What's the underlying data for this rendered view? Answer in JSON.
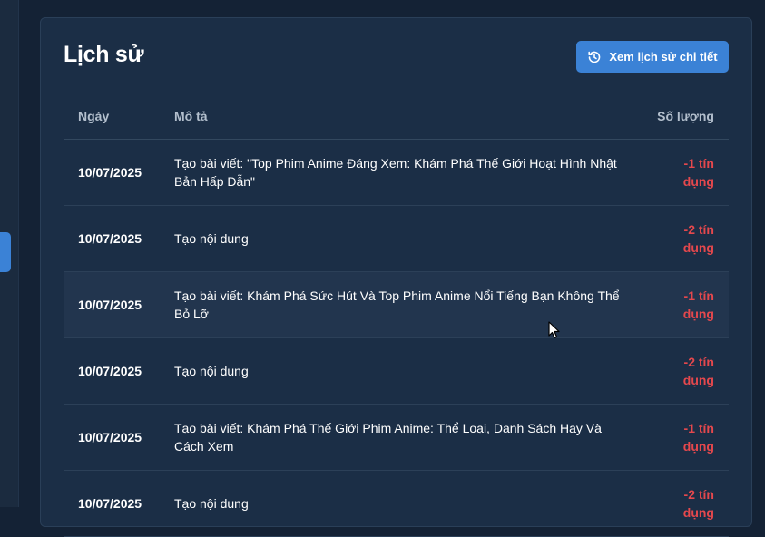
{
  "page": {
    "title": "Lịch sử",
    "detail_button_label": "Xem lịch sử chi tiết"
  },
  "table": {
    "headers": {
      "date": "Ngày",
      "description": "Mô tả",
      "quantity": "Số lượng"
    },
    "rows": [
      {
        "date": "10/07/2025",
        "description": "Tạo bài viết: \"Top Phim Anime Đáng Xem: Khám Phá Thế Giới Hoạt Hình Nhật Bản Hấp Dẫn\"",
        "quantity": "-1 tín dụng"
      },
      {
        "date": "10/07/2025",
        "description": "Tạo nội dung",
        "quantity": "-2 tín dụng"
      },
      {
        "date": "10/07/2025",
        "description": "Tạo bài viết: Khám Phá Sức Hút Và Top Phim Anime Nổi Tiếng Bạn Không Thể Bỏ Lỡ",
        "quantity": "-1 tín dụng"
      },
      {
        "date": "10/07/2025",
        "description": "Tạo nội dung",
        "quantity": "-2 tín dụng"
      },
      {
        "date": "10/07/2025",
        "description": "Tạo bài viết: Khám Phá Thế Giới Phim Anime: Thể Loại, Danh Sách Hay Và Cách Xem",
        "quantity": "-1 tín dụng"
      },
      {
        "date": "10/07/2025",
        "description": "Tạo nội dung",
        "quantity": "-2 tín dụng"
      }
    ]
  },
  "colors": {
    "accent": "#3b82d6",
    "negative": "#e5484d",
    "card_bg": "#1b2e46"
  },
  "icons": {
    "detail_button": "history-icon"
  }
}
